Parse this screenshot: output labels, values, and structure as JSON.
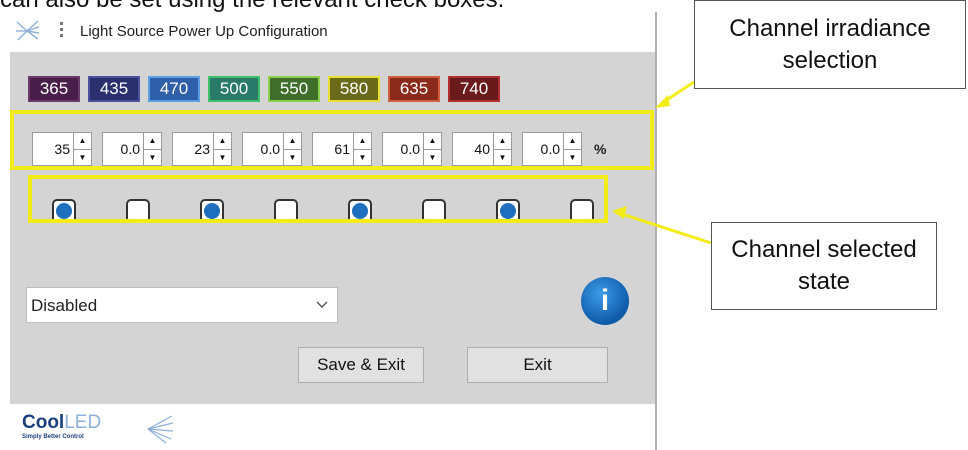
{
  "background_text": "can also be set using the relevant check boxes.",
  "window": {
    "title": "Light Source Power Up Configuration"
  },
  "wavelengths": [
    {
      "label": "365",
      "bg": "#4a1e4a",
      "border": "#6a3a6a"
    },
    {
      "label": "435",
      "bg": "#2a2f6e",
      "border": "#4a52a0"
    },
    {
      "label": "470",
      "bg": "#2f5fa8",
      "border": "#5aa0e0"
    },
    {
      "label": "500",
      "bg": "#2a7a6a",
      "border": "#3fc06a"
    },
    {
      "label": "550",
      "bg": "#3e6e2a",
      "border": "#8ad04a"
    },
    {
      "label": "580",
      "bg": "#6a6a1a",
      "border": "#e8e030"
    },
    {
      "label": "635",
      "bg": "#8a2a1a",
      "border": "#d06040"
    },
    {
      "label": "740",
      "bg": "#6a1a1a",
      "border": "#b03030"
    }
  ],
  "spinners": [
    "35",
    "0.0",
    "23",
    "0.0",
    "61",
    "0.0",
    "40",
    "0.0"
  ],
  "percent_label": "%",
  "checkboxes": [
    true,
    false,
    true,
    false,
    true,
    false,
    true,
    false
  ],
  "dropdown": {
    "selected": "Disabled"
  },
  "info_button": {
    "glyph": "i"
  },
  "buttons": {
    "save_exit": "Save & Exit",
    "exit": "Exit"
  },
  "brand": {
    "name_a": "Cool",
    "name_b": "LED",
    "tagline": "Simply Better Control"
  },
  "callouts": {
    "irradiance": "Channel irradiance selection",
    "selected_state": "Channel selected state"
  },
  "colors": {
    "highlight": "#f3ec19",
    "checkbox_dot": "#1f6fbf",
    "info": "#0d5aa8"
  }
}
